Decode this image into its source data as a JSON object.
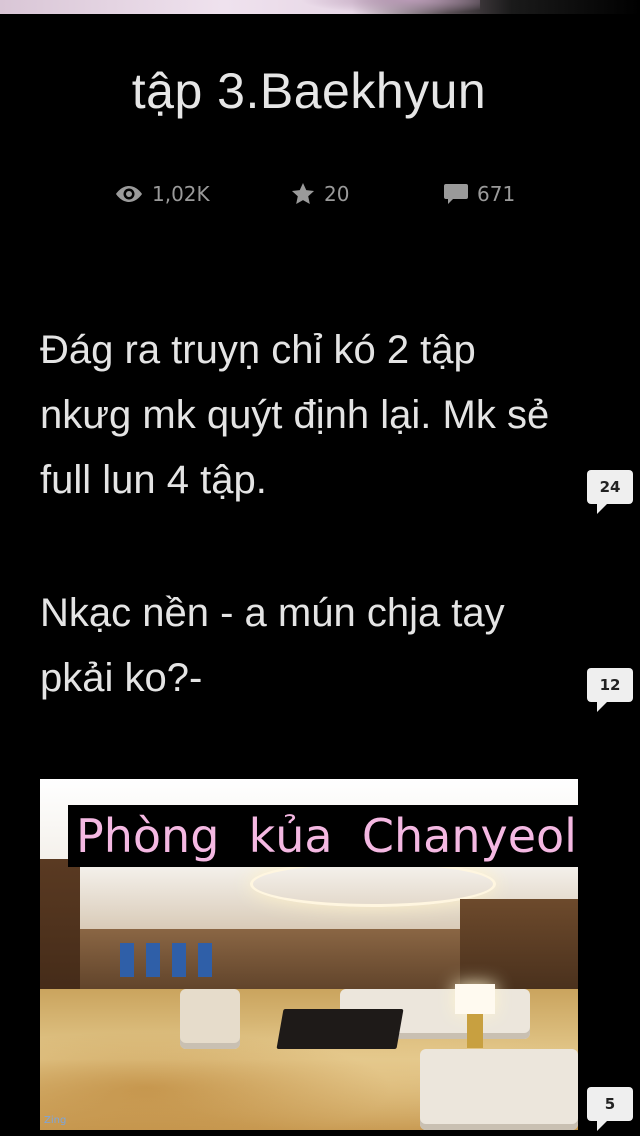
{
  "chapter": {
    "title": "tập 3.Baekhyun"
  },
  "stats": {
    "views": "1,02K",
    "votes": "20",
    "comments": "671",
    "views_icon": "eye-icon",
    "votes_icon": "star-icon",
    "comments_icon": "comment-icon"
  },
  "paragraphs": [
    {
      "lines": [
        "Đág ra truyṇ chỉ kó 2 tập",
        "nkưg mk quýt định lại. Mk sẻ",
        "full lun 4 tập."
      ],
      "comment_count": "24"
    },
    {
      "lines": [
        "Nkạc nền - a mún chja tay",
        "pkải ko?-"
      ],
      "comment_count": "12"
    }
  ],
  "image": {
    "caption": "Phòng  kủa  Chanyeol",
    "watermark": "Zing",
    "comment_count": "5"
  },
  "colors": {
    "background": "#000000",
    "text": "#e4e4e4",
    "stat_text": "#9a9a9a",
    "caption_text": "#f4b8e2",
    "bubble": "#efefef"
  }
}
